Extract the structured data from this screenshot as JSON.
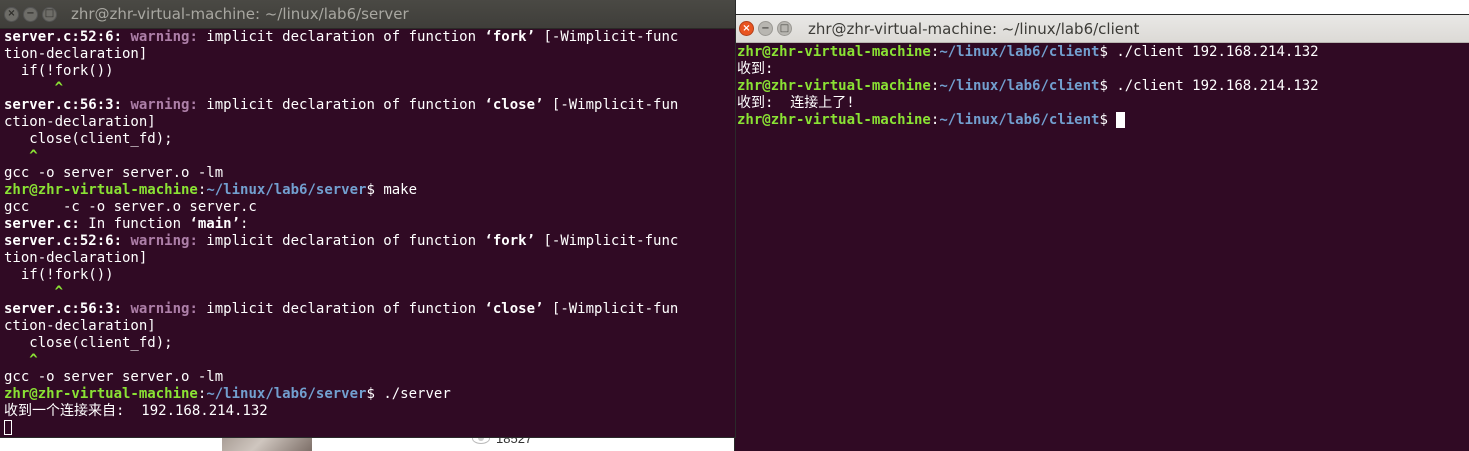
{
  "background_page": {
    "views_count": "18527"
  },
  "server_window": {
    "title": "zhr@zhr-virtual-machine: ~/linux/lab6/server",
    "lines": [
      [
        {
          "t": "server.c:52:6: ",
          "s": "b"
        },
        {
          "t": "warning: ",
          "s": "warn"
        },
        {
          "t": "implicit declaration of function ",
          "s": ""
        },
        {
          "t": "‘fork’",
          "s": "b"
        },
        {
          "t": " [-Wimplicit-func",
          "s": ""
        }
      ],
      [
        {
          "t": "tion-declaration]",
          "s": ""
        }
      ],
      [
        {
          "t": "  if(!fork())",
          "s": ""
        }
      ],
      [
        {
          "t": "      ^",
          "s": "caret"
        }
      ],
      [
        {
          "t": "server.c:56:3: ",
          "s": "b"
        },
        {
          "t": "warning: ",
          "s": "warn"
        },
        {
          "t": "implicit declaration of function ",
          "s": ""
        },
        {
          "t": "‘close’",
          "s": "b"
        },
        {
          "t": " [-Wimplicit-fun",
          "s": ""
        }
      ],
      [
        {
          "t": "ction-declaration]",
          "s": ""
        }
      ],
      [
        {
          "t": "   close(client_fd);",
          "s": ""
        }
      ],
      [
        {
          "t": "   ^",
          "s": "caret"
        }
      ],
      [
        {
          "t": "gcc -o server server.o -lm",
          "s": ""
        }
      ],
      [
        {
          "t": "zhr@zhr-virtual-machine",
          "s": "green"
        },
        {
          "t": ":",
          "s": ""
        },
        {
          "t": "~/linux/lab6/server",
          "s": "blue"
        },
        {
          "t": "$ make",
          "s": ""
        }
      ],
      [
        {
          "t": "gcc    -c -o server.o server.c",
          "s": ""
        }
      ],
      [
        {
          "t": "server.c:",
          "s": "b"
        },
        {
          "t": " In function ",
          "s": ""
        },
        {
          "t": "‘main’",
          "s": "b"
        },
        {
          "t": ":",
          "s": ""
        }
      ],
      [
        {
          "t": "server.c:52:6: ",
          "s": "b"
        },
        {
          "t": "warning: ",
          "s": "warn"
        },
        {
          "t": "implicit declaration of function ",
          "s": ""
        },
        {
          "t": "‘fork’",
          "s": "b"
        },
        {
          "t": " [-Wimplicit-func",
          "s": ""
        }
      ],
      [
        {
          "t": "tion-declaration]",
          "s": ""
        }
      ],
      [
        {
          "t": "  if(!fork())",
          "s": ""
        }
      ],
      [
        {
          "t": "      ^",
          "s": "caret"
        }
      ],
      [
        {
          "t": "server.c:56:3: ",
          "s": "b"
        },
        {
          "t": "warning: ",
          "s": "warn"
        },
        {
          "t": "implicit declaration of function ",
          "s": ""
        },
        {
          "t": "‘close’",
          "s": "b"
        },
        {
          "t": " [-Wimplicit-fun",
          "s": ""
        }
      ],
      [
        {
          "t": "ction-declaration]",
          "s": ""
        }
      ],
      [
        {
          "t": "   close(client_fd);",
          "s": ""
        }
      ],
      [
        {
          "t": "   ^",
          "s": "caret"
        }
      ],
      [
        {
          "t": "gcc -o server server.o -lm",
          "s": ""
        }
      ],
      [
        {
          "t": "zhr@zhr-virtual-machine",
          "s": "green"
        },
        {
          "t": ":",
          "s": ""
        },
        {
          "t": "~/linux/lab6/server",
          "s": "blue"
        },
        {
          "t": "$ ./server",
          "s": ""
        }
      ],
      [
        {
          "t": "收到一个连接来自:  192.168.214.132",
          "s": ""
        }
      ]
    ]
  },
  "client_window": {
    "title": "zhr@zhr-virtual-machine: ~/linux/lab6/client",
    "lines": [
      [
        {
          "t": "zhr@zhr-virtual-machine",
          "s": "green"
        },
        {
          "t": ":",
          "s": ""
        },
        {
          "t": "~/linux/lab6/client",
          "s": "blue"
        },
        {
          "t": "$ ./client 192.168.214.132",
          "s": ""
        }
      ],
      [
        {
          "t": "收到: ",
          "s": ""
        }
      ],
      [
        {
          "t": "zhr@zhr-virtual-machine",
          "s": "green"
        },
        {
          "t": ":",
          "s": ""
        },
        {
          "t": "~/linux/lab6/client",
          "s": "blue"
        },
        {
          "t": "$ ./client 192.168.214.132",
          "s": ""
        }
      ],
      [
        {
          "t": "收到:  连接上了!",
          "s": ""
        }
      ],
      [
        {
          "t": "zhr@zhr-virtual-machine",
          "s": "green"
        },
        {
          "t": ":",
          "s": ""
        },
        {
          "t": "~/linux/lab6/client",
          "s": "blue"
        },
        {
          "t": "$ ",
          "s": ""
        }
      ]
    ]
  },
  "window_buttons": {
    "close": "×",
    "minimize": "−",
    "maximize": "□"
  }
}
